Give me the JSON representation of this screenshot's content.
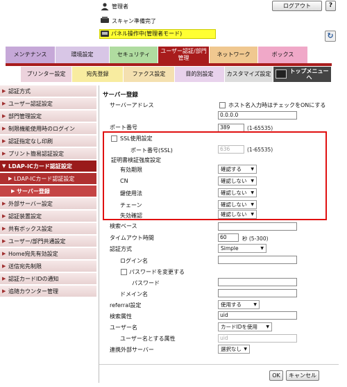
{
  "header": {
    "user": "管理者",
    "scan_status": "スキャン準備完了",
    "panel_status": "パネル操作中(管理者モード)",
    "logout_label": "ログアウト",
    "help_label": "?",
    "refresh_label": "↻"
  },
  "tabs_main": [
    {
      "label": "メンテナンス",
      "color": "#c6a8d8"
    },
    {
      "label": "環境設定",
      "color": "#d8c6e6"
    },
    {
      "label": "セキュリティ",
      "color": "#b0dca0"
    },
    {
      "label": "ユーザー認証/部門管理",
      "color": "#a81c1c"
    },
    {
      "label": "ネットワーク",
      "color": "#f0c890"
    },
    {
      "label": "ボックス",
      "color": "#f0a8c8"
    }
  ],
  "tabs_sub": [
    {
      "label": "プリンター設定",
      "color": "#ecd2dc"
    },
    {
      "label": "宛先登録",
      "color": "#f8eca0"
    },
    {
      "label": "ファクス設定",
      "color": "#f4e0b0"
    },
    {
      "label": "目的別設定",
      "color": "#e8d2ec"
    },
    {
      "label": "カスタマイズ設定",
      "color": "#dcdcdc"
    },
    {
      "label": "トップメニューへ",
      "color": "#444444"
    }
  ],
  "sidebar": [
    {
      "label": "認証方式",
      "kind": "normal"
    },
    {
      "label": "ユーザー認証設定",
      "kind": "normal"
    },
    {
      "label": "部門管理設定",
      "kind": "normal"
    },
    {
      "label": "制限機能使用時のログイン",
      "kind": "normal"
    },
    {
      "label": "認証指定なし印刷",
      "kind": "normal"
    },
    {
      "label": "プリント簡易認証設定",
      "kind": "normal"
    },
    {
      "label": "LDAP-ICカード認証設定",
      "kind": "active"
    },
    {
      "label": "LDAP-ICカード認証設定",
      "kind": "sub"
    },
    {
      "label": "サーバー登録",
      "kind": "sub2"
    },
    {
      "label": "外部サーバー設定",
      "kind": "normal"
    },
    {
      "label": "認証装置設定",
      "kind": "normal"
    },
    {
      "label": "共有ボックス設定",
      "kind": "normal"
    },
    {
      "label": "ユーザー/部門共通設定",
      "kind": "normal"
    },
    {
      "label": "Home宛先有効設定",
      "kind": "normal"
    },
    {
      "label": "送信宛先制限",
      "kind": "normal"
    },
    {
      "label": "認証カードIDの通知",
      "kind": "normal"
    },
    {
      "label": "追随カウンター管理",
      "kind": "normal"
    }
  ],
  "form": {
    "section_title": "サーバー登録",
    "server_address": {
      "label": "サーバーアドレス",
      "checkbox": "ホスト名入力時はチェックをONにする",
      "value": "0.0.0.0"
    },
    "port": {
      "label": "ポート番号",
      "value": "389",
      "range": "(1-65535)"
    },
    "ssl": {
      "label": "SSL使用設定"
    },
    "ssl_port": {
      "label": "ポート番号(SSL)",
      "value": "636",
      "range": "(1-65535)"
    },
    "cert": {
      "label": "証明書検証強度設定"
    },
    "cert_items": [
      {
        "label": "有効期限",
        "value": "確認する"
      },
      {
        "label": "CN",
        "value": "確認しない"
      },
      {
        "label": "鍵使用法",
        "value": "確認しない"
      },
      {
        "label": "チェーン",
        "value": "確認しない"
      },
      {
        "label": "失効確認",
        "value": "確認しない"
      }
    ],
    "search_base": {
      "label": "検索ベース"
    },
    "timeout": {
      "label": "タイムアウト時間",
      "value": "60",
      "unit": "秒 (5-300)"
    },
    "auth_method": {
      "label": "認証方式",
      "value": "Simple"
    },
    "login_name": {
      "label": "ログイン名"
    },
    "change_pw": {
      "label": "パスワードを変更する"
    },
    "password": {
      "label": "パスワード"
    },
    "domain": {
      "label": "ドメイン名"
    },
    "referral": {
      "label": "referral設定",
      "value": "使用する"
    },
    "search_attr": {
      "label": "検索属性",
      "value": "uid"
    },
    "user_name": {
      "label": "ユーザー名",
      "value": "カードIDを使用"
    },
    "user_attr": {
      "label": "ユーザー名とする属性",
      "value": "uid"
    },
    "linked_server": {
      "label": "連携外部サーバー",
      "value": "選択なし"
    }
  },
  "buttons": {
    "ok": "OK",
    "cancel": "キャンセル"
  }
}
